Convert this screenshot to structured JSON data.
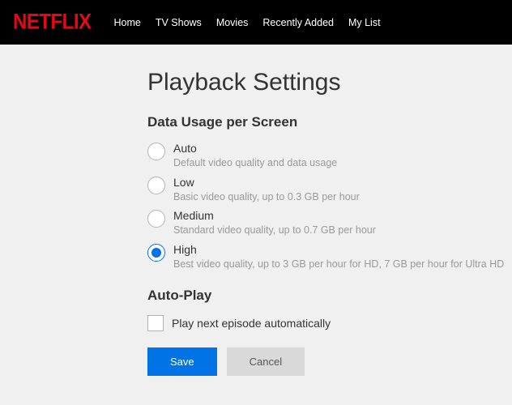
{
  "logo_text": "NETFLIX",
  "nav": {
    "items": [
      {
        "label": "Home"
      },
      {
        "label": "TV Shows"
      },
      {
        "label": "Movies"
      },
      {
        "label": "Recently Added"
      },
      {
        "label": "My List"
      }
    ]
  },
  "page_title": "Playback Settings",
  "data_usage": {
    "heading": "Data Usage per Screen",
    "options": [
      {
        "label": "Auto",
        "desc": "Default video quality and data usage",
        "selected": false
      },
      {
        "label": "Low",
        "desc": "Basic video quality, up to 0.3 GB per hour",
        "selected": false
      },
      {
        "label": "Medium",
        "desc": "Standard video quality, up to 0.7 GB per hour",
        "selected": false
      },
      {
        "label": "High",
        "desc": "Best video quality, up to 3 GB per hour for HD, 7 GB per hour for Ultra HD",
        "selected": true
      }
    ]
  },
  "autoplay": {
    "heading": "Auto-Play",
    "checkbox_label": "Play next episode automatically",
    "checked": false
  },
  "buttons": {
    "save": "Save",
    "cancel": "Cancel"
  }
}
